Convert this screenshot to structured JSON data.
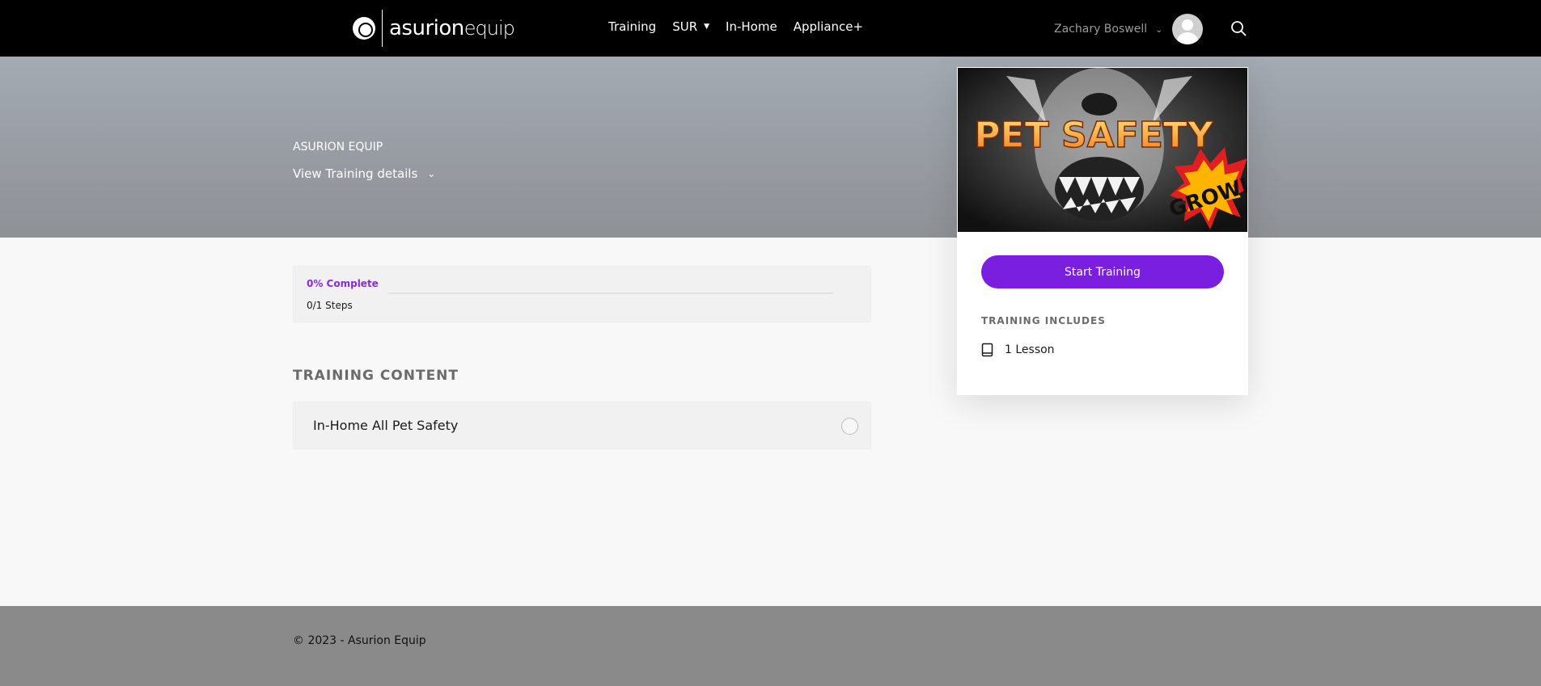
{
  "header": {
    "logo_brand": "asurion",
    "logo_sub": "equip",
    "nav": [
      {
        "label": "Training"
      },
      {
        "label": "SUR"
      },
      {
        "label": "In-Home"
      },
      {
        "label": "Appliance+"
      }
    ],
    "user_name": "Zachary Boswell"
  },
  "hero": {
    "label": "ASURION EQUIP",
    "details_link": "View Training details"
  },
  "progress": {
    "percent_label": "0% Complete",
    "steps_label": "0/1 Steps",
    "fraction": 0
  },
  "content": {
    "section_title": "TRAINING CONTENT",
    "lessons": [
      {
        "title": "In-Home All Pet Safety"
      }
    ]
  },
  "card": {
    "image_title": "PET SAFETY",
    "image_burst": "GROWL",
    "start_label": "Start Training",
    "includes_title": "TRAINING INCLUDES",
    "includes": [
      {
        "icon": "book-icon",
        "label": "1 Lesson"
      }
    ]
  },
  "footer": {
    "copyright": "© 2023 - Asurion Equip"
  },
  "colors": {
    "accent": "#7a1ee0",
    "progress_text": "#8a2bd6",
    "header_bg": "#000000",
    "footer_bg": "#8a8a8a"
  }
}
